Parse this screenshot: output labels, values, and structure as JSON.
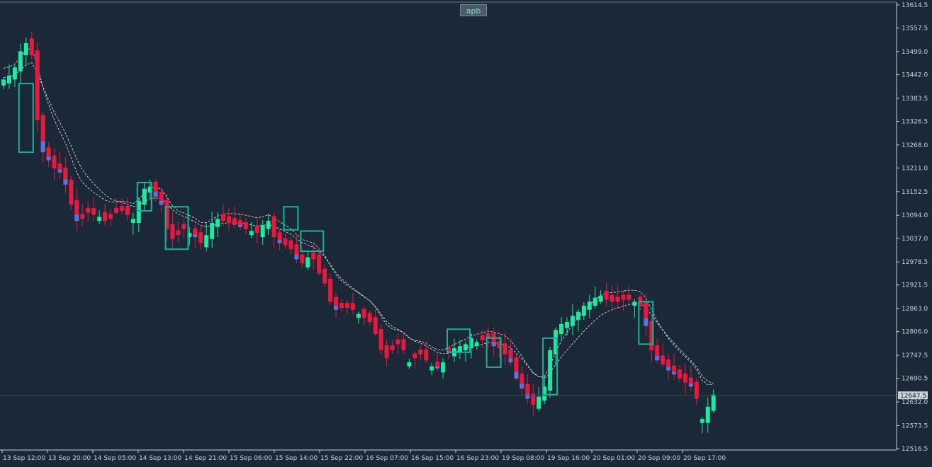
{
  "symbol_button": "apb",
  "current_price_label": "12647.5",
  "colors": {
    "background": "#1b2838",
    "bull": "#1de9a0",
    "bear": "#e8193c",
    "bull_alt": "#5a72e0",
    "box": "#16b39a",
    "ma_line": "#e8e8e8",
    "axis": "#c8d0da"
  },
  "chart_data": {
    "type": "candlestick",
    "title": "",
    "xlabel": "",
    "ylabel": "",
    "ylim": [
      12490,
      13625
    ],
    "y_ticks": [
      "13614.5",
      "13557.5",
      "13499.0",
      "13442.0",
      "13383.5",
      "13326.5",
      "13268.0",
      "13211.0",
      "13152.5",
      "13094.0",
      "13037.0",
      "12978.5",
      "12921.5",
      "12863.0",
      "12806.0",
      "12747.5",
      "12690.5",
      "12632.0",
      "12573.5",
      "12516.5"
    ],
    "x_ticks": [
      "13 Sep 12:00",
      "13 Sep 20:00",
      "14 Sep 05:00",
      "14 Sep 13:00",
      "14 Sep 21:00",
      "15 Sep 06:00",
      "15 Sep 14:00",
      "15 Sep 22:00",
      "16 Sep 07:00",
      "16 Sep 15:00",
      "16 Sep 23:00",
      "19 Sep 08:00",
      "19 Sep 16:00",
      "20 Sep 01:00",
      "20 Sep 09:00",
      "20 Sep 17:00"
    ],
    "close_path": [
      13430,
      13440,
      13460,
      13500,
      13520,
      13490,
      13330,
      13250,
      13230,
      13210,
      13200,
      13170,
      13120,
      13080,
      13085,
      13100,
      13095,
      13090,
      13080,
      13085,
      13100,
      13105,
      13095,
      13085,
      13130,
      13160,
      13165,
      13140,
      13120,
      13060,
      13035,
      13045,
      13060,
      13050,
      13040,
      13025,
      13045,
      13075,
      13085,
      13080,
      13075,
      13070,
      13065,
      13060,
      13055,
      13050,
      13070,
      13080,
      13040,
      13025,
      13020,
      13010,
      12985,
      12975,
      12990,
      12985,
      12950,
      12925,
      12880,
      12860,
      12865,
      12865,
      12860,
      12850,
      12840,
      12830,
      12800,
      12760,
      12740,
      12760,
      12775,
      12760,
      12730,
      12740,
      12750,
      12735,
      12720,
      12715,
      12730,
      12755,
      12765,
      12770,
      12775,
      12790,
      12780,
      12785,
      12790,
      12770,
      12765,
      12750,
      12730,
      12690,
      12665,
      12640,
      12625,
      12645,
      12670,
      12760,
      12810,
      12825,
      12830,
      12845,
      12855,
      12870,
      12880,
      12890,
      12895,
      12885,
      12880,
      12880,
      12885,
      12885,
      12880,
      12870,
      12820,
      12760,
      12735,
      12725,
      12710,
      12700,
      12690,
      12680,
      12670,
      12640,
      12590,
      12620,
      12650
    ],
    "up_markers": [
      0,
      1,
      2,
      3,
      4,
      17,
      23,
      24,
      25,
      26,
      33,
      36,
      37,
      38,
      44,
      46,
      47,
      54,
      63,
      72,
      76,
      78,
      80,
      81,
      82,
      83,
      84,
      95,
      96,
      97,
      98,
      99,
      100,
      101,
      102,
      103,
      104,
      105,
      106,
      112,
      124,
      125,
      126
    ],
    "boxes": [
      {
        "x_index": 4,
        "y_top": 13420,
        "y_bottom": 13250
      },
      {
        "x_index": 25,
        "y_top": 13175,
        "y_bottom": 13105
      },
      {
        "x_index": 30,
        "y_top": 13115,
        "y_bottom": 13010
      },
      {
        "x_index": 51,
        "y_top": 13115,
        "y_bottom": 13058
      },
      {
        "x_index": 54,
        "y_top": 13055,
        "y_bottom": 13005
      },
      {
        "x_index": 80,
        "y_top": 12812,
        "y_bottom": 12755
      },
      {
        "x_index": 87,
        "y_top": 12790,
        "y_bottom": 12718
      },
      {
        "x_index": 97,
        "y_top": 12790,
        "y_bottom": 12650
      },
      {
        "x_index": 114,
        "y_top": 12880,
        "y_bottom": 12775
      }
    ]
  }
}
